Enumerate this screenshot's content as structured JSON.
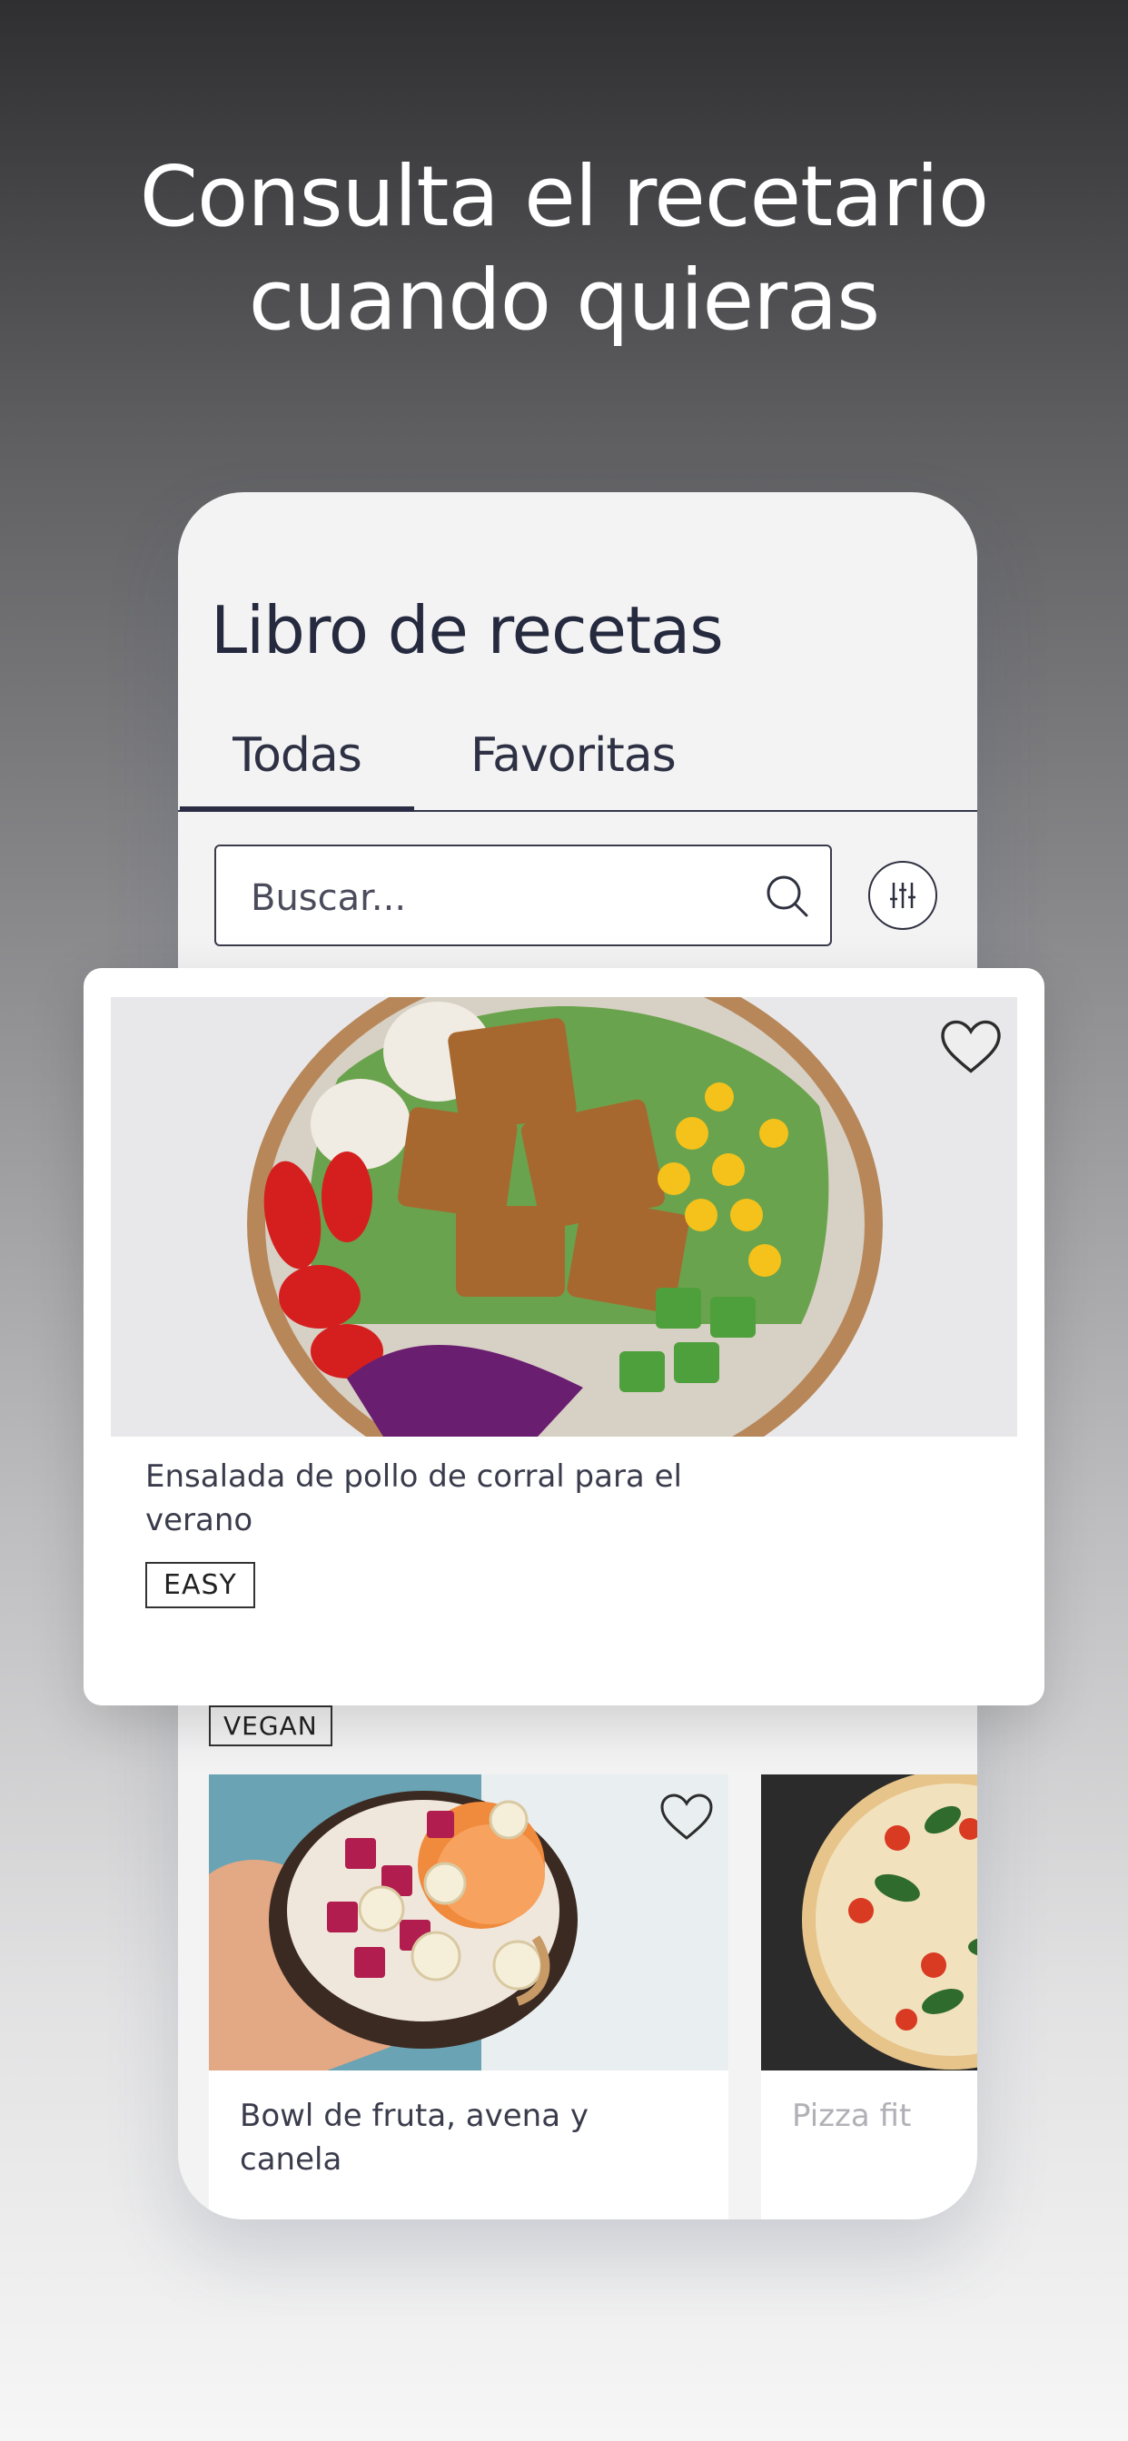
{
  "headline": {
    "line1": "Consulta el recetario",
    "line2": "cuando quieras"
  },
  "app": {
    "title": "Libro de recetas",
    "tabs": [
      {
        "label": "Todas",
        "active": true
      },
      {
        "label": "Favoritas",
        "active": false
      }
    ],
    "search": {
      "placeholder": "Buscar..."
    }
  },
  "featured_recipe": {
    "title": "Ensalada de pollo de corral para el verano",
    "tag": "EASY",
    "favorite": false,
    "image": "salad-bowl-photo"
  },
  "recipes": [
    {
      "title": "Bowl de fruta, avena y canela",
      "tag": "VEGAN",
      "favorite": false,
      "image": "fruit-bowl-photo"
    },
    {
      "title": "Pizza fit",
      "image": "pizza-photo"
    }
  ],
  "colors": {
    "text_dark": "#262a3f",
    "accent": "#2a2d44",
    "card_bg": "#ffffff",
    "app_bg": "#f3f3f4"
  }
}
